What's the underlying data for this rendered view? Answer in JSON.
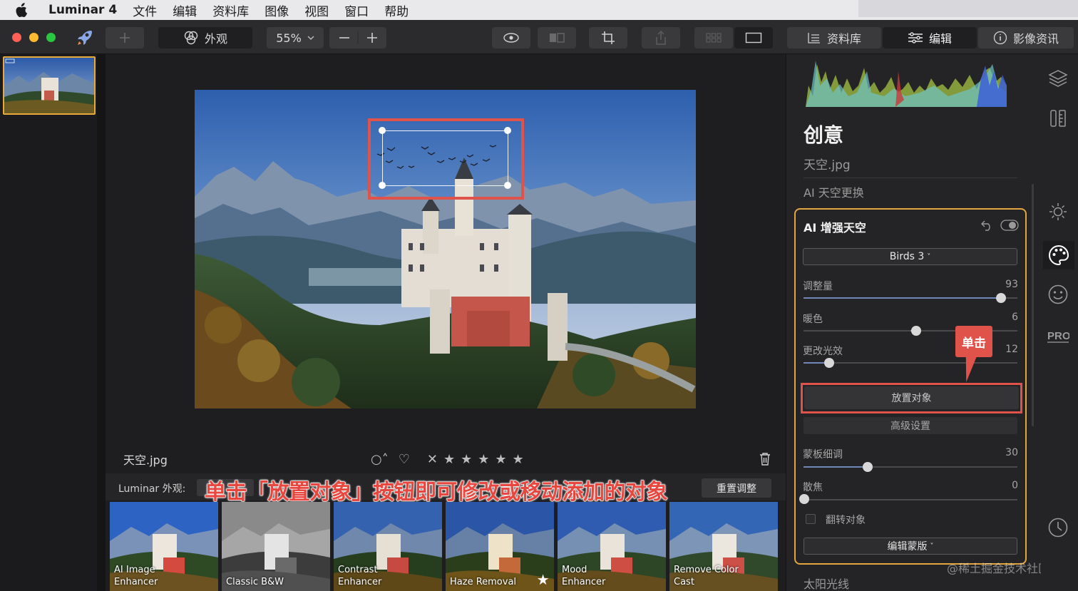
{
  "menubar": {
    "app": "Luminar 4",
    "items": [
      "文件",
      "编辑",
      "资料库",
      "图像",
      "视图",
      "窗口",
      "帮助"
    ]
  },
  "toolbar": {
    "looks_label": "外观",
    "zoom_value": "55%",
    "library_tab": "资料库",
    "edit_tab": "编辑",
    "info_tab": "影像资讯"
  },
  "viewer": {
    "file_name": "天空.jpg",
    "rating_stars": 5
  },
  "looks_bar": {
    "label": "Luminar 外观:",
    "reset_label": "重置调整",
    "annotation": "单击「放置对象」按钮即可修改或移动添加的对象",
    "looks": [
      {
        "line1": "AI Image",
        "line2": "Enhancer"
      },
      {
        "line1": "Classic B&W",
        "line2": ""
      },
      {
        "line1": "Contrast",
        "line2": "Enhancer"
      },
      {
        "line1": "Haze Removal",
        "line2": ""
      },
      {
        "line1": "Mood",
        "line2": "Enhancer"
      },
      {
        "line1": "Remove Color",
        "line2": "Cast"
      }
    ]
  },
  "panel": {
    "title": "创意",
    "file": "天空.jpg",
    "section": "AI 天空更换",
    "card_title": "AI 增强天空",
    "preset": "Birds 3",
    "sliders": {
      "amount": {
        "label": "调整量",
        "value": "93"
      },
      "warmth": {
        "label": "暖色",
        "value": "6"
      },
      "relight": {
        "label": "更改光效",
        "value": "12"
      },
      "mask_refine": {
        "label": "蒙板细调",
        "value": "30"
      },
      "defocus": {
        "label": "散焦",
        "value": "0"
      }
    },
    "callout": "单击",
    "place_button": "放置对象",
    "advanced_button": "高级设置",
    "flip_label": "翻转对象",
    "edit_mask": "编辑蒙版",
    "next_section": "太阳光线",
    "watermark": "@稀土掘金技术社区"
  },
  "colors": {
    "accent_orange": "#e3a63e",
    "annotation_red": "#e0534b",
    "slider_fill": "#6f86b8"
  }
}
